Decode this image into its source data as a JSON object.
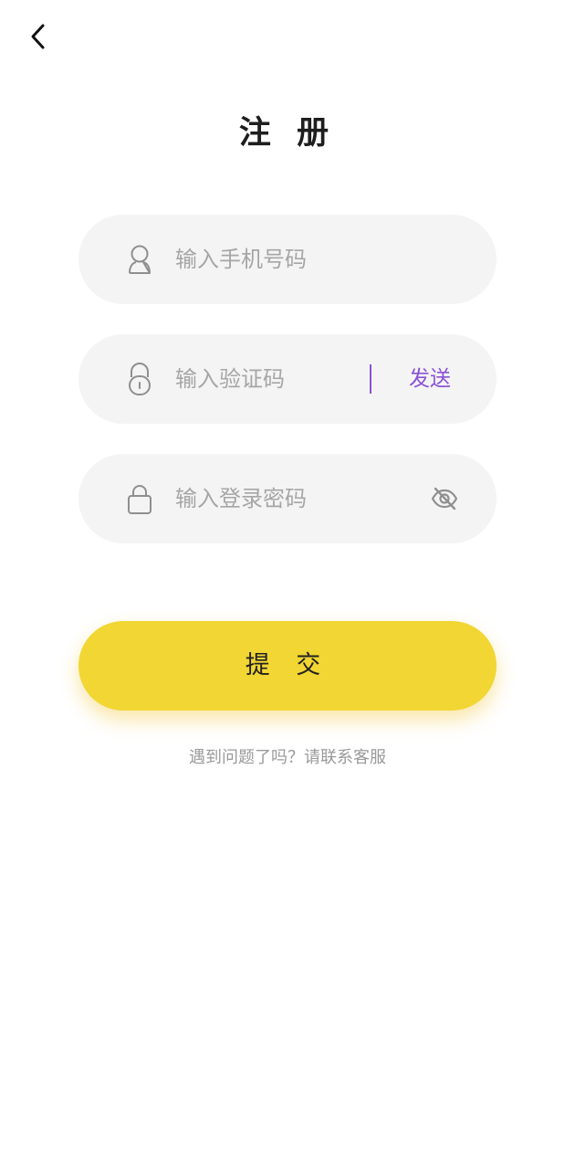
{
  "nav": {
    "back_icon": "chevron-left-icon"
  },
  "page": {
    "title": "注 册"
  },
  "form": {
    "phone": {
      "placeholder": "输入手机号码",
      "value": "",
      "icon": "user-icon"
    },
    "code": {
      "placeholder": "输入验证码",
      "value": "",
      "icon": "lock-keyhole-icon",
      "send_label": "发送"
    },
    "password": {
      "placeholder": "输入登录密码",
      "value": "",
      "icon": "lock-icon",
      "toggle_icon": "eye-off-icon"
    },
    "submit_label": "提 交"
  },
  "help": {
    "text": "遇到问题了吗？请联系客服"
  },
  "colors": {
    "accent": "#8a52d6",
    "primary_button": "#f2d633",
    "field_bg": "#f4f4f4",
    "placeholder": "#a6a6a6"
  }
}
